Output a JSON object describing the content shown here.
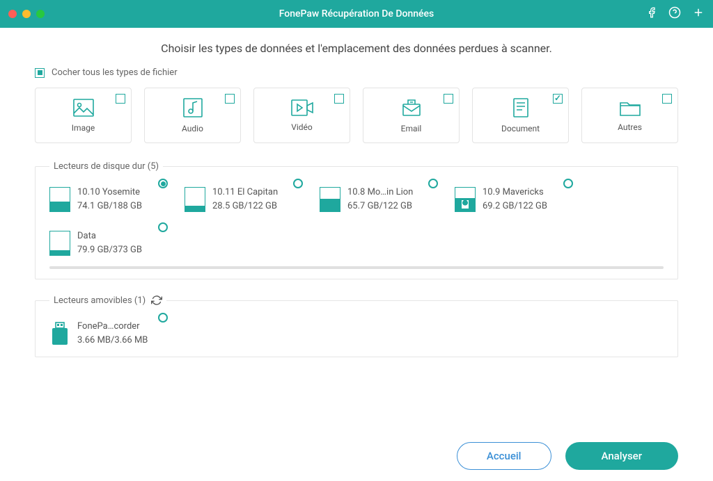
{
  "title": "FonePaw Récupération De Données",
  "heading": "Choisir les types de données et l'emplacement des données perdues à scanner.",
  "select_all_label": "Cocher tous les types de fichier",
  "types": {
    "image": "Image",
    "audio": "Audio",
    "video": "Vidéo",
    "email": "Email",
    "document": "Document",
    "other": "Autres"
  },
  "sections": {
    "hard_drives": "Lecteurs de disque dur (5)",
    "removable": "Lecteurs amovibles (1)"
  },
  "drives": [
    {
      "name": "10.10 Yosemite",
      "size": "74.1 GB/188 GB",
      "fill": 40,
      "selected": true
    },
    {
      "name": "10.11 El Capitan",
      "size": "28.5 GB/122 GB",
      "fill": 23,
      "selected": false
    },
    {
      "name": "10.8 Mo…in Lion",
      "size": "65.7 GB/122 GB",
      "fill": 54,
      "selected": false
    },
    {
      "name": "10.9 Mavericks",
      "size": "69.2 GB/122 GB",
      "fill": 57,
      "selected": false
    },
    {
      "name": "Data",
      "size": "79.9 GB/373 GB",
      "fill": 21,
      "selected": false
    }
  ],
  "removable_drives": [
    {
      "name": "FonePa…corder",
      "size": "3.66 MB/3.66 MB",
      "selected": false
    }
  ],
  "footer": {
    "home": "Accueil",
    "analyze": "Analyser"
  }
}
